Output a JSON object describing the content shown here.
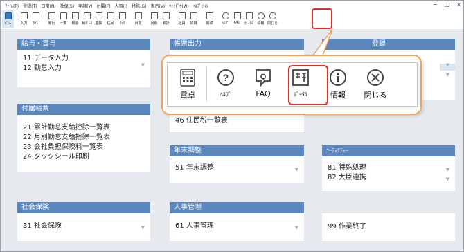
{
  "menu": [
    "ﾌｧｲﾙ(F)",
    "登録(T)",
    "日常(N)",
    "社保(S)",
    "年調(Y)",
    "付属(F)",
    "人事(J)",
    "特殊(G)",
    "表示(V)",
    "ｳｨﾝﾄﾞｳ(W)",
    "ﾍﾙﾌﾟ(H)"
  ],
  "toolbar": [
    {
      "label": "ﾒﾆｭｰ",
      "icon": "menu-icon",
      "active": true
    },
    {
      "label": "入力",
      "icon": "input-icon"
    },
    {
      "label": "ﾀｲﾑ",
      "icon": "time-icon"
    },
    {
      "label": "発行",
      "icon": "issue-icon"
    },
    {
      "label": "一覧",
      "icon": "list-icon"
    },
    {
      "label": "頻源",
      "icon": "source-icon"
    },
    {
      "label": "頻ﾃﾞｰﾀ",
      "icon": "data-icon"
    },
    {
      "label": "金帳",
      "icon": "ledger-icon"
    },
    {
      "label": "住民",
      "icon": "resident-icon"
    },
    {
      "label": "ﾀｯｸ",
      "icon": "tack-icon"
    },
    {
      "label": "月定",
      "icon": "monthly-icon"
    },
    {
      "label": "月別",
      "icon": "month-icon"
    },
    {
      "label": "累計",
      "icon": "total-icon"
    },
    {
      "label": "社員",
      "icon": "employee-icon"
    },
    {
      "label": "項目",
      "icon": "item-icon"
    },
    {
      "label": "電卓",
      "icon": "calculator-icon"
    },
    {
      "label": "ﾍﾙﾌﾟ",
      "icon": "help-icon"
    },
    {
      "label": "FAQ",
      "icon": "faq-icon"
    },
    {
      "label": "ﾎﾟｰﾀﾙ",
      "icon": "portal-icon"
    },
    {
      "label": "情報",
      "icon": "info-icon"
    },
    {
      "label": "閉じる",
      "icon": "close-icon"
    }
  ],
  "panels": {
    "salary": {
      "title": "給与・賞与",
      "items": [
        "11 データ入力",
        "12 勤怠入力"
      ]
    },
    "ledger": {
      "title": "帳票出力",
      "items": [
        "46 住民税一覧表"
      ]
    },
    "hidden_right": {
      "title": "登録"
    },
    "attached": {
      "title": "付属帳票",
      "items": [
        "21 累計勤怠支給控除一覧表",
        "22 月別勤怠支給控除一覧表",
        "23 会社負担保険料一覧表",
        "24 タックシール印刷"
      ]
    },
    "year_end": {
      "title": "年末調整",
      "items": [
        "51 年末調整"
      ]
    },
    "utility": {
      "title": "ﾕｰﾃｨﾘﾃｨｰ",
      "items": [
        "81 特殊処理",
        "82 大臣連携"
      ]
    },
    "social": {
      "title": "社会保険",
      "items": [
        "31 社会保険"
      ]
    },
    "hr": {
      "title": "人事管理",
      "items": [
        "61 人事管理"
      ]
    },
    "end": {
      "items": [
        "99 作業終了"
      ]
    }
  },
  "popup": [
    {
      "label": "電卓",
      "icon": "calculator-icon"
    },
    {
      "label": "ﾍﾙﾌﾟ",
      "icon": "help-icon"
    },
    {
      "label": "FAQ",
      "icon": "faq-icon"
    },
    {
      "label": "ﾎﾟｰﾀﾙ",
      "icon": "portal-icon"
    },
    {
      "label": "情報",
      "icon": "info-icon"
    },
    {
      "label": "閉じる",
      "icon": "close-icon"
    }
  ],
  "colors": {
    "panel_header": "#5b87bd",
    "highlight": "#e0302a",
    "callout": "#f0a35a"
  }
}
